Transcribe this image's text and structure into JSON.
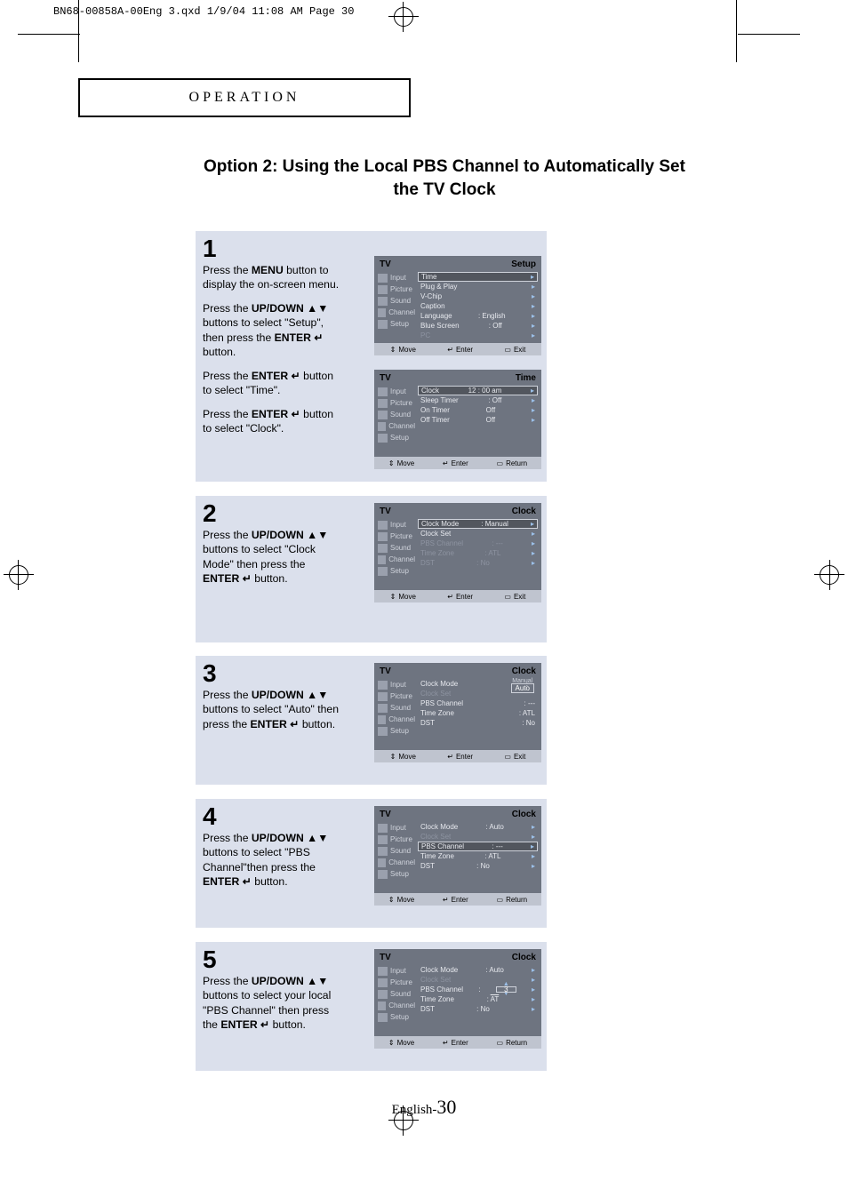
{
  "header_line": "BN68-00858A-00Eng 3.qxd  1/9/04 11:08 AM  Page 30",
  "operation_label": "OPERATION",
  "option_title": "Option 2: Using the Local PBS Channel to Automatically Set the TV Clock",
  "page_footer_prefix": "English-",
  "page_number": "30",
  "arrows_updown": "▲▼",
  "enter_symbol": "↵",
  "steps": {
    "s1": {
      "num": "1",
      "p1a": "Press the ",
      "p1b": "MENU",
      "p1c": " button to display the on-screen menu.",
      "p2a": "Press the ",
      "p2b": "UP/DOWN ",
      "p2c": " buttons to select \"Setup\", then press the ",
      "p2d": "ENTER ",
      "p2e": " button.",
      "p3a": "Press the ",
      "p3b": "ENTER ",
      "p3c": " button to select \"Time\".",
      "p4a": "Press the ",
      "p4b": "ENTER ",
      "p4c": " button to select \"Clock\"."
    },
    "s2": {
      "num": "2",
      "p1a": "Press the ",
      "p1b": "UP/DOWN ",
      "p1c": " buttons to select \"Clock Mode\" then press the ",
      "p1d": "ENTER ",
      "p1e": "  button."
    },
    "s3": {
      "num": "3",
      "p1a": "Press the ",
      "p1b": "UP/DOWN ",
      "p1c": " buttons to select \"Auto\" then press the ",
      "p1d": "ENTER ",
      "p1e": "  button."
    },
    "s4": {
      "num": "4",
      "p1a": "Press the ",
      "p1b": "UP/DOWN ",
      "p1c": " buttons to select \"PBS Channel\"then press the ",
      "p1d": "ENTER ",
      "p1e": "  button."
    },
    "s5": {
      "num": "5",
      "p1a": "Press the ",
      "p1b": "UP/DOWN ",
      "p1c": " buttons to select your local \"PBS Channel\" then press the ",
      "p1d": "ENTER ",
      "p1e": " button."
    }
  },
  "tv": {
    "tv_label": "TV",
    "sidebar": [
      "Input",
      "Picture",
      "Sound",
      "Channel",
      "Setup"
    ],
    "footer": {
      "move": "Move",
      "enter": "Enter",
      "exit": "Exit",
      "return": "Return"
    },
    "setup": {
      "title": "Setup",
      "items": [
        {
          "label": "Time",
          "value": "",
          "hi": true
        },
        {
          "label": "Plug & Play",
          "value": ""
        },
        {
          "label": "V-Chip",
          "value": ""
        },
        {
          "label": "Caption",
          "value": ""
        },
        {
          "label": "Language",
          "value": "English"
        },
        {
          "label": "Blue Screen",
          "value": "Off"
        },
        {
          "label": "PC",
          "value": "",
          "dim": true
        }
      ]
    },
    "time": {
      "title": "Time",
      "items": [
        {
          "label": "Clock",
          "value": "12 : 00  am",
          "hi": true
        },
        {
          "label": "Sleep Timer",
          "value": "Off"
        },
        {
          "label": "On Timer",
          "value": "Off"
        },
        {
          "label": "Off Timer",
          "value": "Off"
        }
      ]
    },
    "clock_manual": {
      "title": "Clock",
      "items": [
        {
          "label": "Clock Mode",
          "value": "Manual",
          "hi": true
        },
        {
          "label": "Clock Set",
          "value": ""
        },
        {
          "label": "PBS Channel",
          "value": "---",
          "dim": true
        },
        {
          "label": "Time Zone",
          "value": "ATL",
          "dim": true
        },
        {
          "label": "DST",
          "value": "No",
          "dim": true
        }
      ]
    },
    "clock_autopick": {
      "title": "Clock",
      "manual_label": "Manual",
      "auto_label": "Auto",
      "items": [
        {
          "label": "Clock Mode",
          "value": ""
        },
        {
          "label": "Clock Set",
          "value": "",
          "dim": true
        },
        {
          "label": "PBS Channel",
          "value": "---"
        },
        {
          "label": "Time Zone",
          "value": "ATL"
        },
        {
          "label": "DST",
          "value": "No"
        }
      ]
    },
    "clock_auto_pbs_hi": {
      "title": "Clock",
      "items": [
        {
          "label": "Clock Mode",
          "value": "Auto"
        },
        {
          "label": "Clock Set",
          "value": "",
          "dim": true
        },
        {
          "label": "PBS Channel",
          "value": "---",
          "hi": true
        },
        {
          "label": "Time Zone",
          "value": "ATL"
        },
        {
          "label": "DST",
          "value": "No"
        }
      ]
    },
    "clock_pbs_select": {
      "title": "Clock",
      "pbs_value": "3",
      "at_value": "AT",
      "items": [
        {
          "label": "Clock Mode",
          "value": "Auto"
        },
        {
          "label": "Clock Set",
          "value": "",
          "dim": true
        },
        {
          "label": "PBS Channel",
          "value": ""
        },
        {
          "label": "Time Zone",
          "value": ""
        },
        {
          "label": "DST",
          "value": "No"
        }
      ]
    }
  }
}
